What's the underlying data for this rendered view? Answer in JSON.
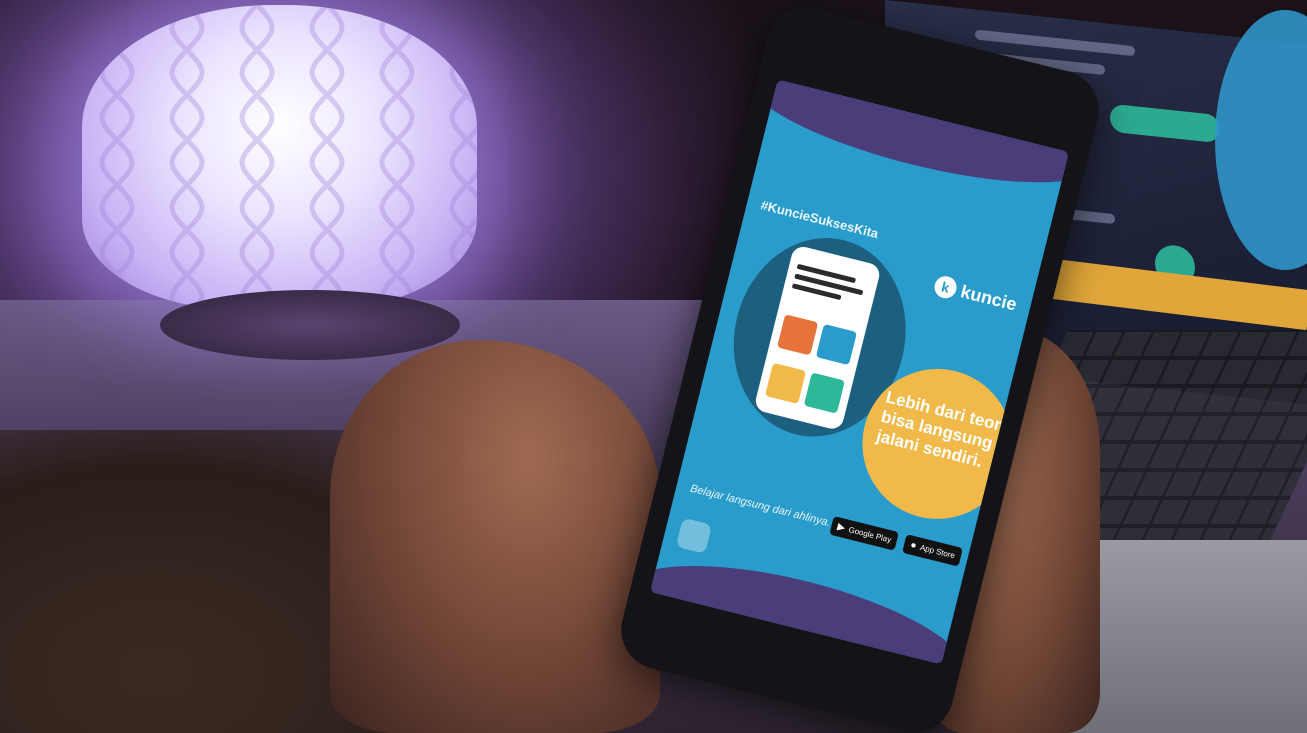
{
  "phone_screen": {
    "hashtag": "#KuncieSuksesKita",
    "logo_mark": "k",
    "logo_text": "kuncie",
    "tagline": "Lebih dari teori bisa langsung jalani sendiri.",
    "subtitle": "Belajar langsung dari ahlinya.",
    "badges": {
      "google_play": "Google Play",
      "app_store": "App Store"
    }
  },
  "colors": {
    "screen_blue": "#2a9ccb",
    "wave_purple": "#4a3d7a",
    "accent_yellow": "#f0b94a",
    "lamp_glow": "#c9b4f5"
  }
}
